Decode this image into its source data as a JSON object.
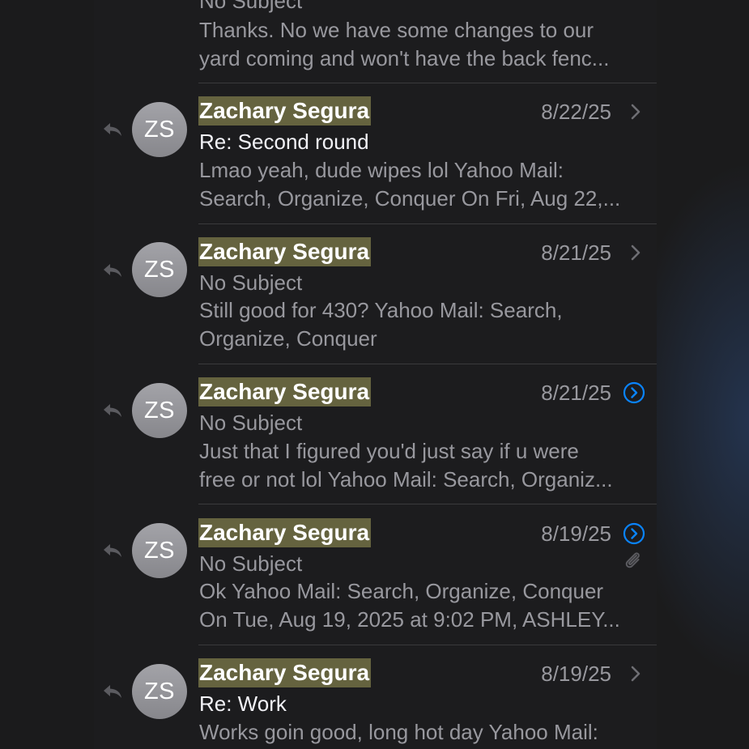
{
  "partial_message": {
    "subject": "No Subject",
    "preview_lines": [
      "Thanks. No we have some changes to our",
      "yard coming and won't have the back fenc..."
    ]
  },
  "messages": [
    {
      "initials": "ZS",
      "sender": "Zachary Segura",
      "date": "8/22/25",
      "subject": "Re: Second round",
      "preview_lines": [
        "Lmao yeah, dude wipes lol Yahoo Mail:",
        "Search, Organize, Conquer On Fri, Aug 22,..."
      ],
      "trailing_icon": "chevron-right-icon"
    },
    {
      "initials": "ZS",
      "sender": "Zachary Segura",
      "date": "8/21/25",
      "subject": "No Subject",
      "preview_lines": [
        "Still good for 430? Yahoo Mail: Search,",
        "Organize, Conquer"
      ],
      "trailing_icon": "chevron-right-icon"
    },
    {
      "initials": "ZS",
      "sender": "Zachary Segura",
      "date": "8/21/25",
      "subject": "No Subject",
      "preview_lines": [
        "Just that I figured you'd just say if u were",
        "free or not lol Yahoo Mail: Search, Organiz..."
      ],
      "trailing_icon": "thread-expand-icon"
    },
    {
      "initials": "ZS",
      "sender": "Zachary Segura",
      "date": "8/19/25",
      "subject": "No Subject",
      "preview_lines": [
        "Ok Yahoo Mail: Search, Organize, Conquer",
        "On Tue, Aug 19, 2025 at 9:02 PM, ASHLEY..."
      ],
      "trailing_icon": "thread-expand-icon",
      "attachment_icon": "paperclip-icon"
    },
    {
      "initials": "ZS",
      "sender": "Zachary Segura",
      "date": "8/19/25",
      "subject": "Re: Work",
      "preview_lines": [
        "Works goin good, long hot day Yahoo Mail:"
      ],
      "trailing_icon": "chevron-right-icon"
    }
  ],
  "colors": {
    "highlight": "#65633f",
    "accent_blue": "#0a84ff",
    "secondary_text": "#98989e",
    "background": "#1c1c1e"
  }
}
